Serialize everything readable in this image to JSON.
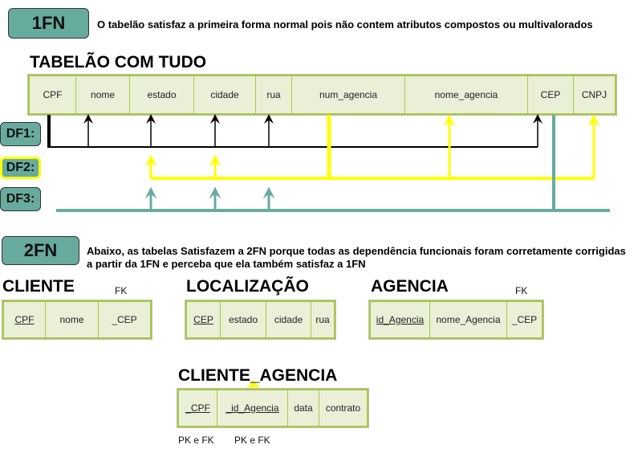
{
  "section1": {
    "badge": "1FN",
    "note": "O tabelão satisfaz a primeira forma normal pois não contem atributos compostos ou multivalorados",
    "table_title": "TABELÃO COM TUDO",
    "columns": [
      "CPF",
      "nome",
      "estado",
      "cidade",
      "rua",
      "num_agencia",
      "nome_agencia",
      "CEP",
      "CNPJ"
    ]
  },
  "dependencies": [
    {
      "label": "DF1:",
      "color": "#000000"
    },
    {
      "label": "DF2:",
      "color": "#ffff00"
    },
    {
      "label": "DF3:",
      "color": "#67ab9f"
    }
  ],
  "section2": {
    "badge": "2FN",
    "note": "Abaixo, as tabelas Satisfazem a 2FN porque todas as dependência funcionais foram corretamente corrigidas a partir da 1FN e perceba que ela também satisfaz a 1FN"
  },
  "tables": {
    "cliente": {
      "title": "CLIENTE",
      "fk": "FK",
      "columns": [
        "CPF",
        "nome",
        "_CEP"
      ]
    },
    "localizacao": {
      "title": "LOCALIZAÇÃO",
      "columns": [
        "CEP",
        "estado",
        "cidade",
        "rua"
      ]
    },
    "agencia": {
      "title": "AGENCIA",
      "fk": "FK",
      "columns": [
        "id_Agencia",
        "nome_Agencia",
        "_CEP"
      ]
    },
    "cliente_agencia": {
      "title": "CLIENTE_AGENCIA",
      "columns": [
        "_CPF",
        "_id_Agencia",
        "data",
        "contrato"
      ],
      "keys": [
        "PK e FK",
        "PK e FK"
      ]
    }
  },
  "colors": {
    "badge": "#67ab9f",
    "table_fill": "#eaf0d7",
    "table_border": "#a9c93c"
  }
}
